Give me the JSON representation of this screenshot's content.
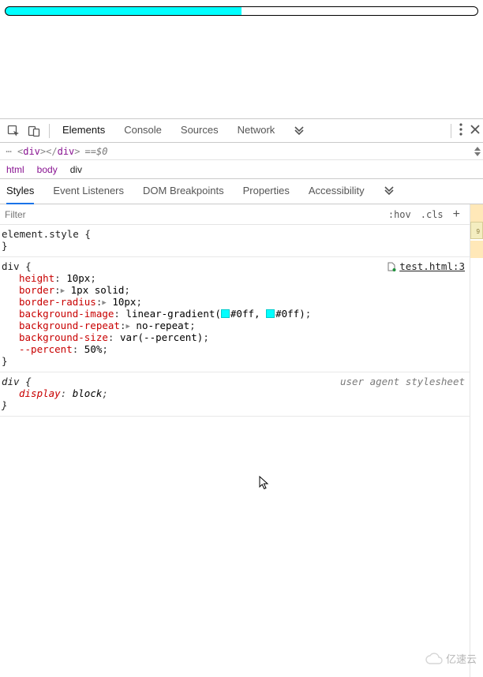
{
  "page": {
    "progress_percent": "50%"
  },
  "toolbar": {
    "tabs": [
      "Elements",
      "Console",
      "Sources",
      "Network"
    ],
    "active_tab": 0
  },
  "dom": {
    "open_tag_name": "div",
    "close_tag_name": "div",
    "equals": " == ",
    "selected_var": "$0"
  },
  "breadcrumb": {
    "items": [
      "html",
      "body",
      "div"
    ],
    "active_index": 2
  },
  "subtabs": {
    "items": [
      "Styles",
      "Event Listeners",
      "DOM Breakpoints",
      "Properties",
      "Accessibility"
    ],
    "active_index": 0
  },
  "filter": {
    "placeholder": "Filter",
    "hov_label": ":hov",
    "cls_label": ".cls",
    "plus_label": "+"
  },
  "rules": {
    "inline": {
      "selector": "element.style",
      "open": "{",
      "close": "}"
    },
    "source_link": "test.html:3",
    "div_rule": {
      "selector": "div",
      "open": "{",
      "close": "}",
      "decls": [
        {
          "prop": "height",
          "raw": "10px"
        },
        {
          "prop": "border",
          "raw": "1px solid",
          "expand": true
        },
        {
          "prop": "border-radius",
          "raw": "10px",
          "expand": true
        },
        {
          "prop": "background-image",
          "raw_pre": "linear-gradient(",
          "sw1": "#00ffff",
          "c1": "#0ff",
          "mid": ", ",
          "sw2": "#00ffff",
          "c2": "#0ff",
          "raw_post": ")"
        },
        {
          "prop": "background-repeat",
          "raw": "no-repeat",
          "expand": true
        },
        {
          "prop": "background-size",
          "raw": "var(--percent)"
        },
        {
          "prop": "--percent",
          "raw": "50%"
        }
      ]
    },
    "ua": {
      "label": "user agent stylesheet",
      "selector": "div",
      "open": "{",
      "close": "}",
      "decls": [
        {
          "prop": "display",
          "raw": "block"
        }
      ]
    }
  },
  "watermark": {
    "text": "亿速云"
  }
}
